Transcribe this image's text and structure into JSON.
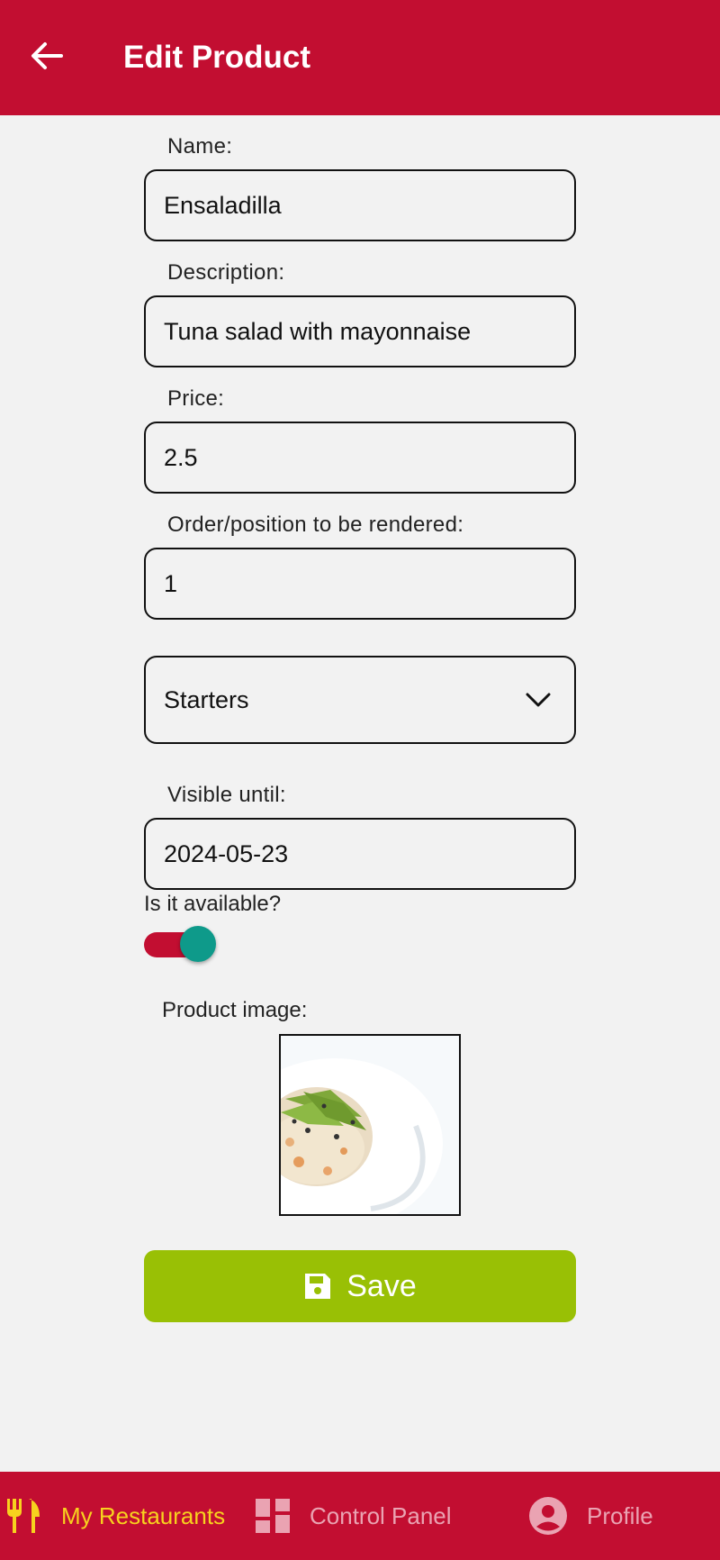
{
  "header": {
    "title": "Edit Product",
    "back_icon": "arrow-left-icon"
  },
  "form": {
    "name": {
      "label": "Name:",
      "value": "Ensaladilla"
    },
    "description": {
      "label": "Description:",
      "value": "Tuna salad with mayonnaise"
    },
    "price": {
      "label": "Price:",
      "value": "2.5"
    },
    "order": {
      "label": "Order/position to be rendered:",
      "value": "1"
    },
    "category": {
      "selected": "Starters",
      "icon": "chevron-down-icon"
    },
    "visible_until": {
      "label": "Visible until:",
      "value": "2024-05-23"
    },
    "available": {
      "label": "Is it available?",
      "on": true
    },
    "image": {
      "label": "Product image:"
    }
  },
  "save_button": {
    "label": "Save",
    "icon": "save-icon"
  },
  "bottom_nav": {
    "items": [
      {
        "label": "My Restaurants",
        "icon": "restaurant-icon",
        "active": true
      },
      {
        "label": "Control Panel",
        "icon": "dashboard-icon",
        "active": false
      },
      {
        "label": "Profile",
        "icon": "account-circle-icon",
        "active": false
      }
    ]
  },
  "colors": {
    "primary": "#c20e31",
    "accent": "#f7d21e",
    "save": "#99c005",
    "toggle_thumb": "#0e9a8a",
    "background": "#f2f2f2"
  }
}
